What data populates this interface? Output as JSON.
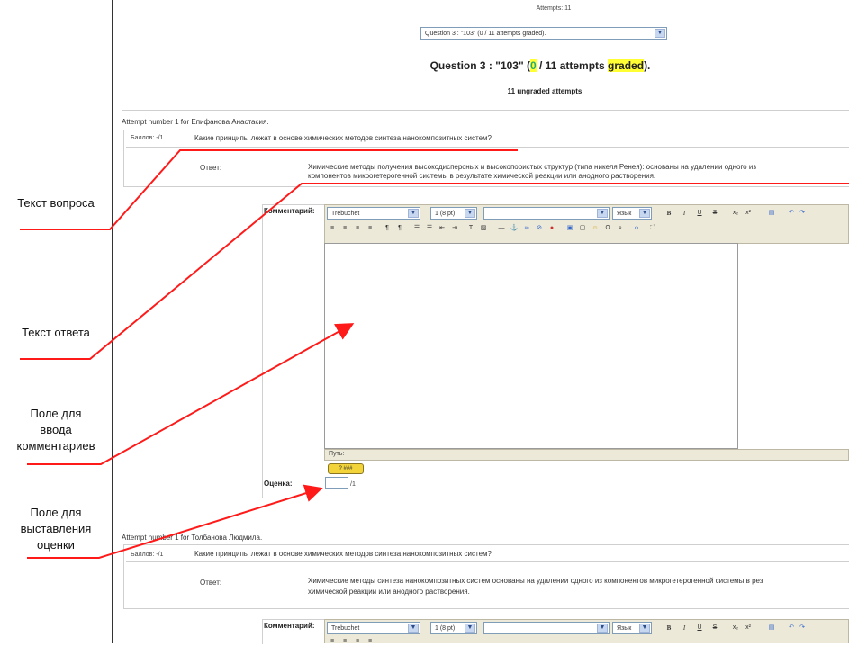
{
  "header": {
    "attempts_label": "Attempts: 11",
    "question_select": "Question 3 : \"103\" (0 / 11 attempts graded).",
    "heading_prefix": "Question 3 : \"103\" (",
    "heading_zero": "0",
    "heading_mid": " / 11 attempts ",
    "heading_graded": "graded",
    "heading_suffix": ").",
    "ungraded": "11 ungraded attempts"
  },
  "attempt1": {
    "title": "Attempt number 1 for Епифанова Анастасия.",
    "points": "Баллов: -/1",
    "question": "Какие принципы лежат в основе химических методов синтеза нанокомпозитных систем?",
    "answer_label": "Ответ:",
    "answer_line1": "Химические методы получения высокодисперсных и высокопористых структур (типа никеля Ренея): основаны на удалении одного из",
    "answer_line2": "компонентов микрогетерогенной системы в результате химической реакции или анодного растворения.",
    "comment_label": "Комментарий:",
    "font_select": "Trebuchet",
    "size_select": "1 (8 pt)",
    "lang_select": "Язык",
    "path_label": "Путь:",
    "help_label": "? ###",
    "grade_label": "Оценка:",
    "grade_value": "",
    "grade_max": "/1"
  },
  "attempt2": {
    "title": "Attempt number 1 for Толбанова Людмила.",
    "points": "Баллов: -/1",
    "question": "Какие принципы лежат в основе химических методов синтеза нанокомпозитных систем?",
    "answer_label": "Ответ:",
    "answer_line1": "Химические методы синтеза нанокомпозитных систем основаны на удалении одного из компонентов микрогетерогенной системы в рез",
    "answer_line2": "химической реакции или анодного растворения.",
    "comment_label": "Комментарий:",
    "font_select": "Trebuchet",
    "size_select": "1 (8 pt)",
    "lang_select": "Язык"
  },
  "annotations": {
    "question_text": "Текст вопроса",
    "answer_text": "Текст ответа",
    "comment_field_1": "Поле для",
    "comment_field_2": "ввода",
    "comment_field_3": "комментариев",
    "grade_field_1": "Поле для",
    "grade_field_2": "выставления",
    "grade_field_3": "оценки"
  },
  "colors": {
    "annotation_red": "#ff1a1a",
    "highlight_yellow": "#ffff33",
    "graded_zero_green": "#22aa77"
  }
}
